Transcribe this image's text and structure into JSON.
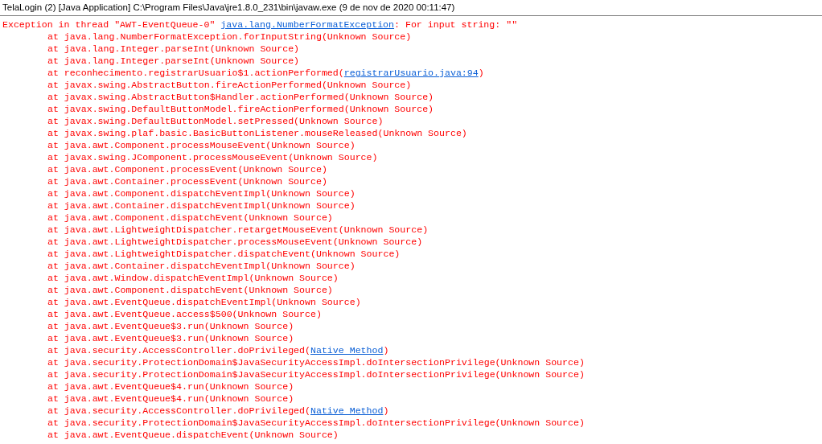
{
  "console": {
    "title": "TelaLogin (2) [Java Application] C:\\Program Files\\Java\\jre1.8.0_231\\bin\\javaw.exe (9 de nov de 2020 00:11:47)"
  },
  "lines": [
    {
      "kind": "exception",
      "segments": [
        {
          "kind": "text",
          "text": "Exception in thread \"AWT-EventQueue-0\" "
        },
        {
          "kind": "link",
          "text": "java.lang.NumberFormatException"
        },
        {
          "kind": "text",
          "text": ": For input string: \"\""
        }
      ]
    },
    {
      "kind": "frame",
      "segments": [
        {
          "kind": "text",
          "text": "at java.lang.NumberFormatException.forInputString(Unknown Source)"
        }
      ]
    },
    {
      "kind": "frame",
      "segments": [
        {
          "kind": "text",
          "text": "at java.lang.Integer.parseInt(Unknown Source)"
        }
      ]
    },
    {
      "kind": "frame",
      "segments": [
        {
          "kind": "text",
          "text": "at java.lang.Integer.parseInt(Unknown Source)"
        }
      ]
    },
    {
      "kind": "frame",
      "segments": [
        {
          "kind": "text",
          "text": "at reconhecimento.registrarUsuario$1.actionPerformed("
        },
        {
          "kind": "link",
          "text": "registrarUsuario.java:94"
        },
        {
          "kind": "text",
          "text": ")"
        }
      ]
    },
    {
      "kind": "frame",
      "segments": [
        {
          "kind": "text",
          "text": "at javax.swing.AbstractButton.fireActionPerformed(Unknown Source)"
        }
      ]
    },
    {
      "kind": "frame",
      "segments": [
        {
          "kind": "text",
          "text": "at javax.swing.AbstractButton$Handler.actionPerformed(Unknown Source)"
        }
      ]
    },
    {
      "kind": "frame",
      "segments": [
        {
          "kind": "text",
          "text": "at javax.swing.DefaultButtonModel.fireActionPerformed(Unknown Source)"
        }
      ]
    },
    {
      "kind": "frame",
      "segments": [
        {
          "kind": "text",
          "text": "at javax.swing.DefaultButtonModel.setPressed(Unknown Source)"
        }
      ]
    },
    {
      "kind": "frame",
      "segments": [
        {
          "kind": "text",
          "text": "at javax.swing.plaf.basic.BasicButtonListener.mouseReleased(Unknown Source)"
        }
      ]
    },
    {
      "kind": "frame",
      "segments": [
        {
          "kind": "text",
          "text": "at java.awt.Component.processMouseEvent(Unknown Source)"
        }
      ]
    },
    {
      "kind": "frame",
      "segments": [
        {
          "kind": "text",
          "text": "at javax.swing.JComponent.processMouseEvent(Unknown Source)"
        }
      ]
    },
    {
      "kind": "frame",
      "segments": [
        {
          "kind": "text",
          "text": "at java.awt.Component.processEvent(Unknown Source)"
        }
      ]
    },
    {
      "kind": "frame",
      "segments": [
        {
          "kind": "text",
          "text": "at java.awt.Container.processEvent(Unknown Source)"
        }
      ]
    },
    {
      "kind": "frame",
      "segments": [
        {
          "kind": "text",
          "text": "at java.awt.Component.dispatchEventImpl(Unknown Source)"
        }
      ]
    },
    {
      "kind": "frame",
      "segments": [
        {
          "kind": "text",
          "text": "at java.awt.Container.dispatchEventImpl(Unknown Source)"
        }
      ]
    },
    {
      "kind": "frame",
      "segments": [
        {
          "kind": "text",
          "text": "at java.awt.Component.dispatchEvent(Unknown Source)"
        }
      ]
    },
    {
      "kind": "frame",
      "segments": [
        {
          "kind": "text",
          "text": "at java.awt.LightweightDispatcher.retargetMouseEvent(Unknown Source)"
        }
      ]
    },
    {
      "kind": "frame",
      "segments": [
        {
          "kind": "text",
          "text": "at java.awt.LightweightDispatcher.processMouseEvent(Unknown Source)"
        }
      ]
    },
    {
      "kind": "frame",
      "segments": [
        {
          "kind": "text",
          "text": "at java.awt.LightweightDispatcher.dispatchEvent(Unknown Source)"
        }
      ]
    },
    {
      "kind": "frame",
      "segments": [
        {
          "kind": "text",
          "text": "at java.awt.Container.dispatchEventImpl(Unknown Source)"
        }
      ]
    },
    {
      "kind": "frame",
      "segments": [
        {
          "kind": "text",
          "text": "at java.awt.Window.dispatchEventImpl(Unknown Source)"
        }
      ]
    },
    {
      "kind": "frame",
      "segments": [
        {
          "kind": "text",
          "text": "at java.awt.Component.dispatchEvent(Unknown Source)"
        }
      ]
    },
    {
      "kind": "frame",
      "segments": [
        {
          "kind": "text",
          "text": "at java.awt.EventQueue.dispatchEventImpl(Unknown Source)"
        }
      ]
    },
    {
      "kind": "frame",
      "segments": [
        {
          "kind": "text",
          "text": "at java.awt.EventQueue.access$500(Unknown Source)"
        }
      ]
    },
    {
      "kind": "frame",
      "segments": [
        {
          "kind": "text",
          "text": "at java.awt.EventQueue$3.run(Unknown Source)"
        }
      ]
    },
    {
      "kind": "frame",
      "segments": [
        {
          "kind": "text",
          "text": "at java.awt.EventQueue$3.run(Unknown Source)"
        }
      ]
    },
    {
      "kind": "frame",
      "segments": [
        {
          "kind": "text",
          "text": "at java.security.AccessController.doPrivileged("
        },
        {
          "kind": "link",
          "text": "Native Method"
        },
        {
          "kind": "text",
          "text": ")"
        }
      ]
    },
    {
      "kind": "frame",
      "segments": [
        {
          "kind": "text",
          "text": "at java.security.ProtectionDomain$JavaSecurityAccessImpl.doIntersectionPrivilege(Unknown Source)"
        }
      ]
    },
    {
      "kind": "frame",
      "segments": [
        {
          "kind": "text",
          "text": "at java.security.ProtectionDomain$JavaSecurityAccessImpl.doIntersectionPrivilege(Unknown Source)"
        }
      ]
    },
    {
      "kind": "frame",
      "segments": [
        {
          "kind": "text",
          "text": "at java.awt.EventQueue$4.run(Unknown Source)"
        }
      ]
    },
    {
      "kind": "frame",
      "segments": [
        {
          "kind": "text",
          "text": "at java.awt.EventQueue$4.run(Unknown Source)"
        }
      ]
    },
    {
      "kind": "frame",
      "segments": [
        {
          "kind": "text",
          "text": "at java.security.AccessController.doPrivileged("
        },
        {
          "kind": "link",
          "text": "Native Method"
        },
        {
          "kind": "text",
          "text": ")"
        }
      ]
    },
    {
      "kind": "frame",
      "segments": [
        {
          "kind": "text",
          "text": "at java.security.ProtectionDomain$JavaSecurityAccessImpl.doIntersectionPrivilege(Unknown Source)"
        }
      ]
    },
    {
      "kind": "frame",
      "segments": [
        {
          "kind": "text",
          "text": "at java.awt.EventQueue.dispatchEvent(Unknown Source)"
        }
      ]
    }
  ]
}
